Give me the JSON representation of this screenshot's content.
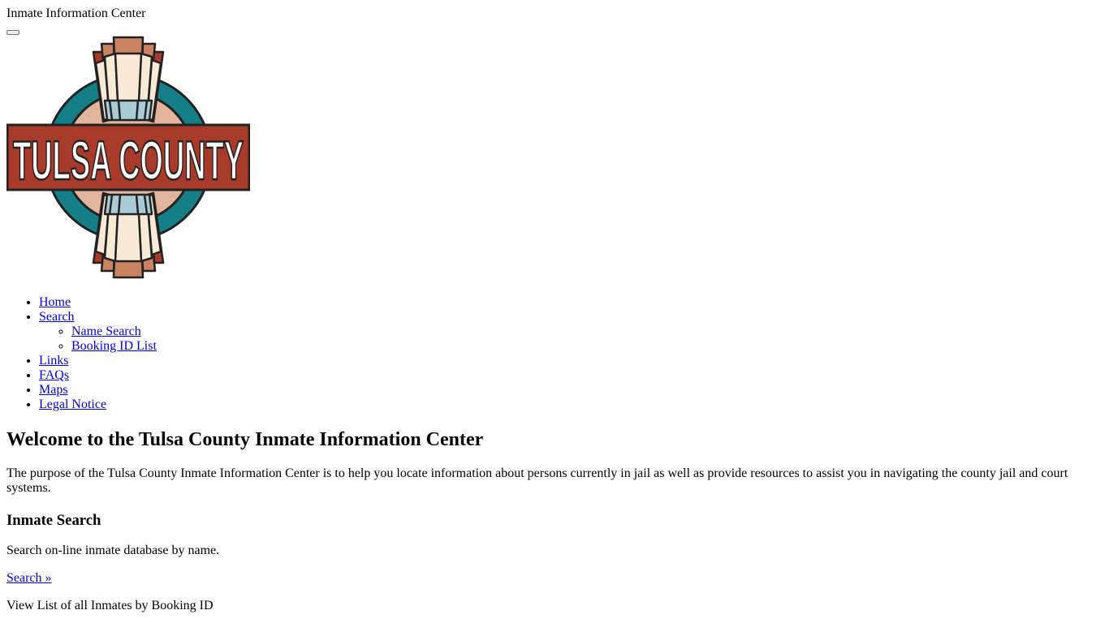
{
  "site": {
    "title": "Inmate Information Center"
  },
  "logo": {
    "text": "TULSA COUNTY",
    "colors": {
      "red": "#a83a2a",
      "teal": "#157f88",
      "peach": "#e2b49c",
      "cream": "#f8ead6",
      "terracotta": "#c98360",
      "lightblue": "#a9cbd6",
      "outline": "#222222"
    }
  },
  "nav": {
    "items": [
      {
        "label": "Home"
      },
      {
        "label": "Search",
        "children": [
          {
            "label": "Name Search"
          },
          {
            "label": "Booking ID List"
          }
        ]
      },
      {
        "label": "Links"
      },
      {
        "label": "FAQs"
      },
      {
        "label": "Maps"
      },
      {
        "label": "Legal Notice"
      }
    ]
  },
  "main": {
    "heading": "Welcome to the Tulsa County Inmate Information Center",
    "intro": "The purpose of the Tulsa County Inmate Information Center is to help you locate information about persons currently in jail as well as provide resources to assist you in navigating the county jail and court systems.",
    "inmate_search": {
      "heading": "Inmate Search",
      "description": "Search on-line inmate database by name.",
      "link": "Search »",
      "list_text": "View List of all Inmates by Booking ID"
    }
  }
}
